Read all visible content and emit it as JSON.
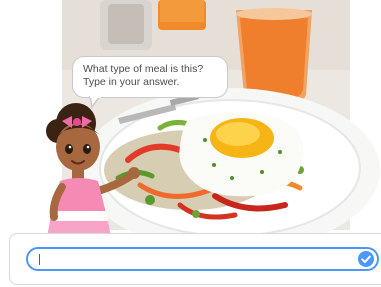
{
  "speech_bubble": {
    "line1": "What type of meal is this?",
    "line2": "Type in your answer."
  },
  "answer": {
    "value": "",
    "submit_icon": "check-icon"
  },
  "colors": {
    "accent": "#4c97ff",
    "text": "#575e75"
  }
}
